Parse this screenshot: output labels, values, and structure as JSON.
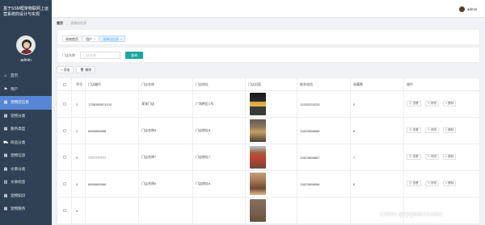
{
  "sidebar": {
    "title": "基于SSM框架物联网上运营系统的设计与实现",
    "username": "admin",
    "items": [
      {
        "icon": "home-icon",
        "label": "首页"
      },
      {
        "icon": "flag-icon",
        "label": "用户"
      },
      {
        "icon": "grid-icon",
        "label": "宠物店信息"
      },
      {
        "icon": "grid-icon",
        "label": "宠物分类"
      },
      {
        "icon": "grid-icon",
        "label": "服务类型"
      },
      {
        "icon": "cart-icon",
        "label": "商品分类"
      },
      {
        "icon": "grid-icon",
        "label": "宠物信息"
      },
      {
        "icon": "grid-icon",
        "label": "文章分类"
      },
      {
        "icon": "bar-icon",
        "label": "文章标签"
      },
      {
        "icon": "grid-icon",
        "label": "宠物知识"
      },
      {
        "icon": "grid-icon",
        "label": "宠物服务"
      }
    ],
    "active_index": 2
  },
  "topbar": {
    "username": "admin"
  },
  "breadcrumb": {
    "home": "首页",
    "current": "宠物店信息"
  },
  "tags": [
    {
      "label": "系统首页",
      "closable": false
    },
    {
      "label": "用户",
      "closable": true
    },
    {
      "label": "宠物店信息",
      "closable": true
    }
  ],
  "search": {
    "label": "门店名称",
    "placeholder": "门店名称",
    "button": "查询"
  },
  "actions": {
    "add": "+ 添加",
    "delete": "删除"
  },
  "table": {
    "headers": [
      "",
      "序号",
      "门店编号",
      "门店名称",
      "门店地址",
      "门店封面",
      "联系电话",
      "收藏数",
      "操作"
    ],
    "rows": [
      {
        "index": "1",
        "code": "1758396813193",
        "name": "宠宠门店",
        "address": "广场附近1号",
        "phone": "13333333225",
        "favs": "0"
      },
      {
        "index": "2",
        "code": "8888888888",
        "name": "门店名称8",
        "address": "门店地址8",
        "phone": "13823888888",
        "favs": "8"
      },
      {
        "index": "3",
        "code": "7777777777",
        "name": "门店名称7",
        "address": "门店地址7",
        "phone": "13823888887",
        "favs": "7"
      },
      {
        "index": "4",
        "code": "6666666666",
        "name": "门店名称6",
        "address": "门店地址6",
        "phone": "13823888886",
        "favs": "6"
      },
      {
        "index": "5",
        "code": "",
        "name": "",
        "address": "",
        "phone": "",
        "favs": ""
      }
    ],
    "ops": {
      "view": "查看",
      "edit": "修改",
      "delete": "删除"
    }
  },
  "watermark": "CSDN @QQ860234001",
  "colors": {
    "sidebar": "#304156",
    "active": "#5686d4",
    "search_button": "#19a7a0"
  }
}
